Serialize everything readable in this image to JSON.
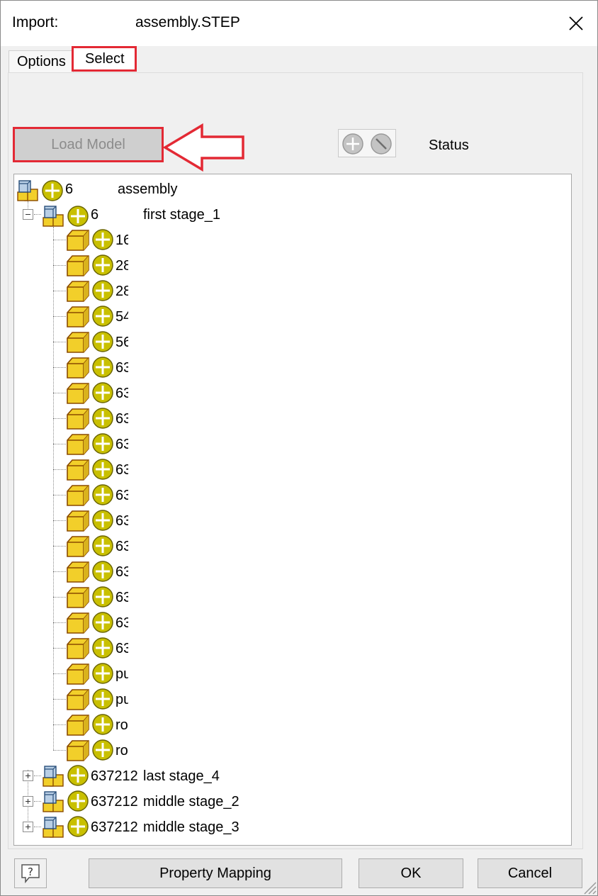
{
  "titlebar": {
    "label": "Import:",
    "filename": "assembly.STEP",
    "close_glyph": "×"
  },
  "tabs": [
    {
      "label": "Options",
      "active": false
    },
    {
      "label": "Select",
      "active": true
    }
  ],
  "toolbar": {
    "load_model_label": "Load Model",
    "status_label": "Status",
    "include_icon": "plus-circle-icon",
    "exclude_icon": "slash-circle-icon"
  },
  "tree": {
    "root": {
      "num": "6",
      "name": "assembly"
    },
    "first_stage": {
      "num": "6",
      "name": "first stage_1",
      "expanded": true
    },
    "children": [
      {
        "num": "16"
      },
      {
        "num": "28"
      },
      {
        "num": "28"
      },
      {
        "num": "54"
      },
      {
        "num": "56"
      },
      {
        "num": "63"
      },
      {
        "num": "63"
      },
      {
        "num": "63"
      },
      {
        "num": "63"
      },
      {
        "num": "63"
      },
      {
        "num": "63"
      },
      {
        "num": "63"
      },
      {
        "num": "63"
      },
      {
        "num": "63"
      },
      {
        "num": "63"
      },
      {
        "num": "63"
      },
      {
        "num": "63"
      },
      {
        "num": "pu"
      },
      {
        "num": "pu"
      },
      {
        "num": "ro"
      },
      {
        "num": "ro"
      }
    ],
    "collapsed": [
      {
        "num": "637212",
        "name": "last stage_4"
      },
      {
        "num": "637212",
        "name": "middle stage_2"
      },
      {
        "num": "637212",
        "name": "middle stage_3"
      }
    ]
  },
  "buttons": {
    "help_glyph": "?",
    "property_mapping": "Property Mapping",
    "ok": "OK",
    "cancel": "Cancel"
  },
  "colors": {
    "highlight": "#e32934",
    "part_yellow": "#f2cf2a",
    "status_yellow": "#c9c000"
  }
}
